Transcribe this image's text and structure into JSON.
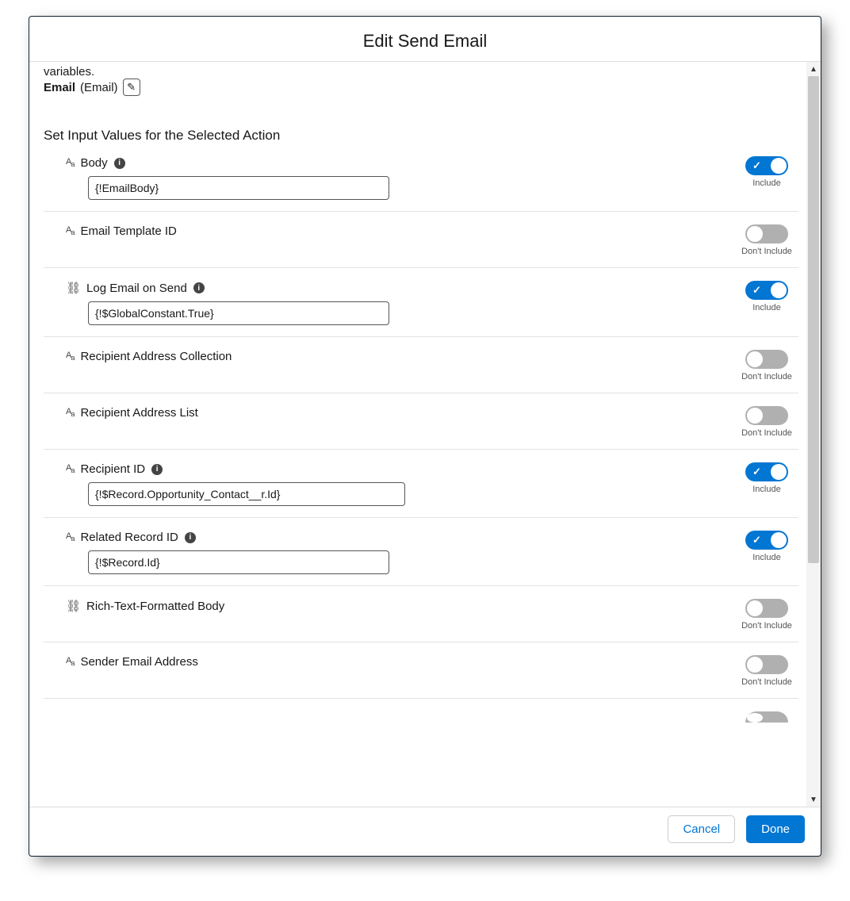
{
  "header": {
    "title": "Edit Send Email"
  },
  "intro": {
    "variables_line": "variables.",
    "email_bold": "Email",
    "email_paren": "(Email)"
  },
  "section_title": "Set Input Values for the Selected Action",
  "toggle_labels": {
    "on": "Include",
    "off": "Don't Include"
  },
  "fields": {
    "body": {
      "label": "Body",
      "type": "text",
      "info": true,
      "include": true,
      "value": "{!EmailBody}"
    },
    "email_template_id": {
      "label": "Email Template ID",
      "type": "text",
      "info": false,
      "include": false
    },
    "log_email": {
      "label": "Log Email on Send",
      "type": "link",
      "info": true,
      "include": true,
      "value": "{!$GlobalConstant.True}"
    },
    "recip_coll": {
      "label": "Recipient Address Collection",
      "type": "text",
      "info": false,
      "include": false
    },
    "recip_list": {
      "label": "Recipient Address List",
      "type": "text",
      "info": false,
      "include": false
    },
    "recipient_id": {
      "label": "Recipient ID",
      "type": "text",
      "info": true,
      "include": true,
      "value": "{!$Record.Opportunity_Contact__r.Id}"
    },
    "related_record": {
      "label": "Related Record ID",
      "type": "text",
      "info": true,
      "include": true,
      "value": "{!$Record.Id}"
    },
    "rich_text": {
      "label": "Rich-Text-Formatted Body",
      "type": "link",
      "info": false,
      "include": false
    },
    "sender_email": {
      "label": "Sender Email Address",
      "type": "text",
      "info": false,
      "include": false
    }
  },
  "footer": {
    "cancel": "Cancel",
    "done": "Done"
  }
}
